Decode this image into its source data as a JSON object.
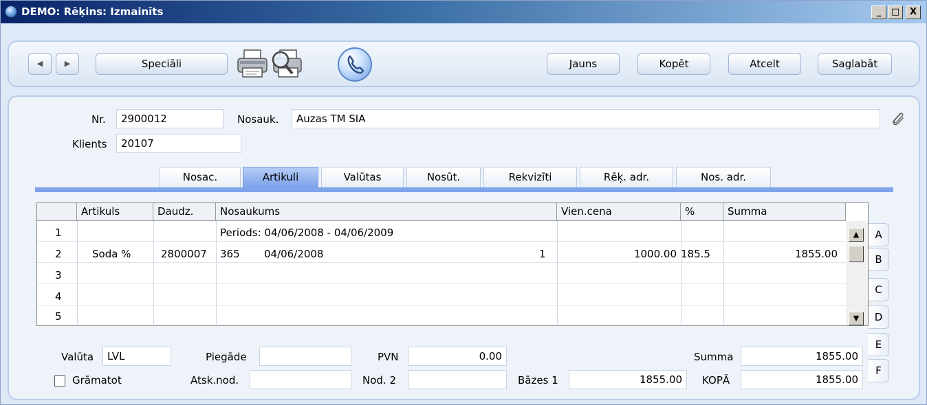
{
  "window": {
    "title": "DEMO: Rēķins: Izmainīts",
    "controls": [
      "_",
      "□",
      "X"
    ]
  },
  "toolbar": {
    "prev_icon": "◀",
    "next_icon": "▶",
    "special_label": "Speciāli",
    "print_icon": "printer-icon",
    "preview_icon": "print-preview-icon",
    "phone_icon": "phone-icon",
    "new_label": "Jauns",
    "copy_label": "Kopēt",
    "cancel_label": "Atcelt",
    "save_label": "Saglabāt"
  },
  "header": {
    "nr_label": "Nr.",
    "nr_value": "2900012",
    "name_label": "Nosauk.",
    "name_value": "Auzas TM SIA",
    "client_label": "Klients",
    "client_value": "20107"
  },
  "tabs": [
    "Nosac.",
    "Artikuli",
    "Valūtas",
    "Nosūt.",
    "Rekvizīti",
    "Rēķ. adr.",
    "Nos. adr."
  ],
  "active_tab": "Artikuli",
  "grid": {
    "columns": [
      "Artikuls",
      "Daudz.",
      "Nosaukums",
      "Vien.cena",
      "%",
      "Summa"
    ],
    "rows": [
      {
        "num": "1",
        "text": "Periods:  04/06/2008 - 04/06/2009"
      },
      {
        "num": "2",
        "article": "Soda %",
        "qty": "2800007",
        "days": "365",
        "date": "04/06/2008",
        "count": "1",
        "price": "1000.00",
        "pct": "185.5",
        "sum": "1855.00"
      },
      {
        "num": "3"
      },
      {
        "num": "4"
      },
      {
        "num": "5"
      }
    ],
    "side_tabs": [
      "A",
      "B",
      "C",
      "D",
      "E",
      "F"
    ]
  },
  "footer": {
    "currency_label": "Valūta",
    "currency_value": "LVL",
    "delivery_label": "Piegāde",
    "delivery_value": "",
    "vat_label": "PVN",
    "vat_value": "0.00",
    "sum_label": "Summa",
    "sum_value": "1855.00",
    "post_label": "Grāmatot",
    "tax_label": "Atsk.nod.",
    "tax_value": "",
    "nod2_label": "Nod. 2",
    "nod2_value": "",
    "base1_label": "Bāzes 1",
    "base1_value": "1855.00",
    "total_label": "KOPĀ",
    "total_value": "1855.00"
  }
}
